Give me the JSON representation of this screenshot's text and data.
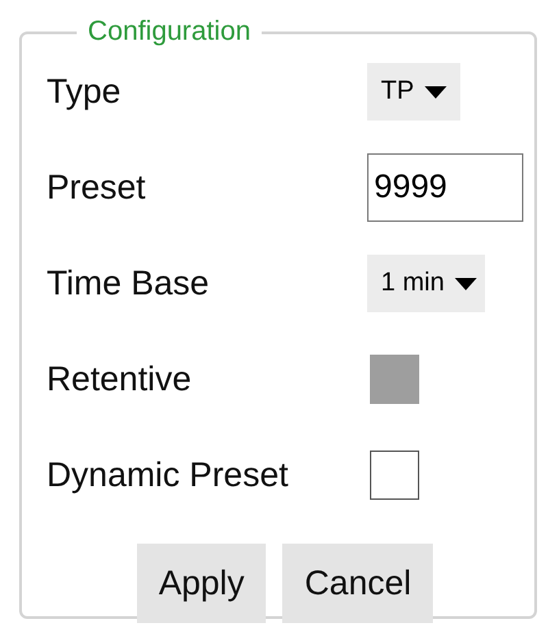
{
  "group": {
    "title": "Configuration"
  },
  "fields": [
    {
      "kind": "dropdown",
      "label": "Type",
      "value": "TP"
    },
    {
      "kind": "input",
      "label": "Preset",
      "value": "9999"
    },
    {
      "kind": "dropdown",
      "label": "Time Base",
      "value": "1 min"
    },
    {
      "kind": "checkbox",
      "label": "Retentive",
      "checked": false,
      "disabled": true
    },
    {
      "kind": "checkbox",
      "label": "Dynamic Preset",
      "checked": false,
      "disabled": false
    }
  ],
  "buttons": [
    "Apply",
    "Cancel"
  ]
}
